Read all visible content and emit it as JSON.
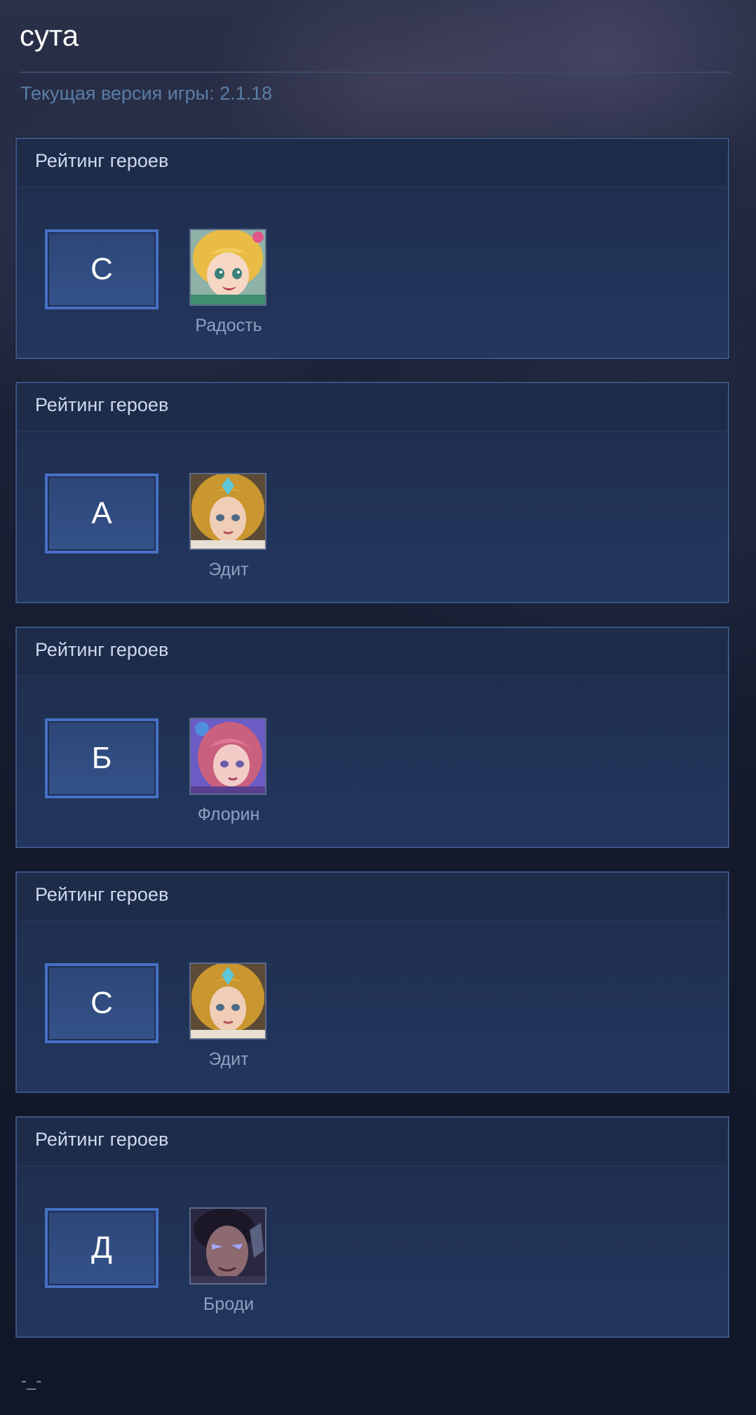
{
  "page": {
    "title": "сута",
    "version_text": "Текущая версия игры: 2.1.18",
    "footer": "-_-"
  },
  "tiers": [
    {
      "panel_title": "Рейтинг героев",
      "tier": "С",
      "hero": {
        "name": "Радость",
        "portrait": "portrait-joy"
      }
    },
    {
      "panel_title": "Рейтинг героев",
      "tier": "А",
      "hero": {
        "name": "Эдит",
        "portrait": "portrait-edith"
      }
    },
    {
      "panel_title": "Рейтинг героев",
      "tier": "Б",
      "hero": {
        "name": "Флорин",
        "portrait": "portrait-floryn"
      }
    },
    {
      "panel_title": "Рейтинг героев",
      "tier": "С",
      "hero": {
        "name": "Эдит",
        "portrait": "portrait-edith"
      }
    },
    {
      "panel_title": "Рейтинг героев",
      "tier": "Д",
      "hero": {
        "name": "Броди",
        "portrait": "portrait-brody"
      }
    }
  ],
  "colors": {
    "background": "#111827",
    "panel_border": "#3c5585",
    "tier_border": "#4670c4",
    "version_text": "#5a7ea8"
  }
}
